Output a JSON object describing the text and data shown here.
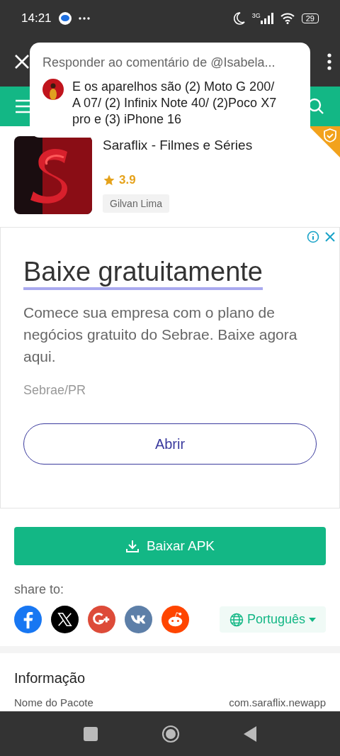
{
  "status_bar": {
    "time": "14:21",
    "network": "3G",
    "battery": "29"
  },
  "reply_popup": {
    "title": "Responder ao comentário de @Isabela...",
    "comment": "E os aparelhos são (2) Moto G 200/ A 07/ (2) Infinix Note 40/ (2)Poco X7 pro e  (3) iPhone 16"
  },
  "app": {
    "title": "Saraflix - Filmes e Séries",
    "rating": "3.9",
    "author": "Gilvan Lima"
  },
  "ad": {
    "headline": "Baixe gratuitamente",
    "body": "Comece sua empresa com o plano de negócios gratuito do Sebrae. Baixe agora aqui.",
    "source": "Sebrae/PR",
    "button": "Abrir"
  },
  "download_button": "Baixar APK",
  "share": {
    "label": "share to:",
    "networks": [
      {
        "kind": "facebook"
      },
      {
        "kind": "x"
      },
      {
        "kind": "google"
      },
      {
        "kind": "vk"
      },
      {
        "kind": "reddit"
      }
    ],
    "language": "Português"
  },
  "info": {
    "heading": "Informação",
    "rows": [
      {
        "label": "Nome do Pacote",
        "value": "com.saraflix.newapp"
      }
    ]
  }
}
